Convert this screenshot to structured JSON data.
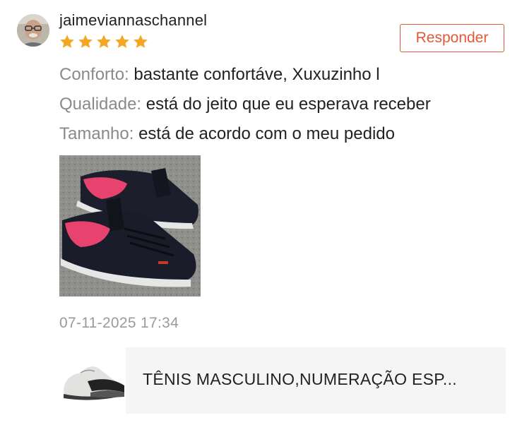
{
  "review": {
    "username": "jaimeviannaschannel",
    "rating": 5,
    "rating_max": 5,
    "reply_label": "Responder",
    "lines": [
      {
        "label": "Conforto:",
        "value": "bastante confortáve, Xuxuzinho l"
      },
      {
        "label": "Qualidade:",
        "value": "está do jeito que eu esperava receber"
      },
      {
        "label": "Tamanho:",
        "value": "está de acordo com o meu pedido"
      }
    ],
    "timestamp": "07-11-2025 17:34"
  },
  "product": {
    "title": "TÊNIS MASCULINO,NUMERAÇÃO ESP..."
  },
  "colors": {
    "accent": "#e05a3a",
    "star": "#f5a623",
    "label_gray": "#8a8a8a",
    "timestamp_gray": "#9a9a9a",
    "card_background": "#f5f5f5"
  },
  "icons": {
    "rating": "star-icon",
    "avatar": "user-avatar"
  }
}
